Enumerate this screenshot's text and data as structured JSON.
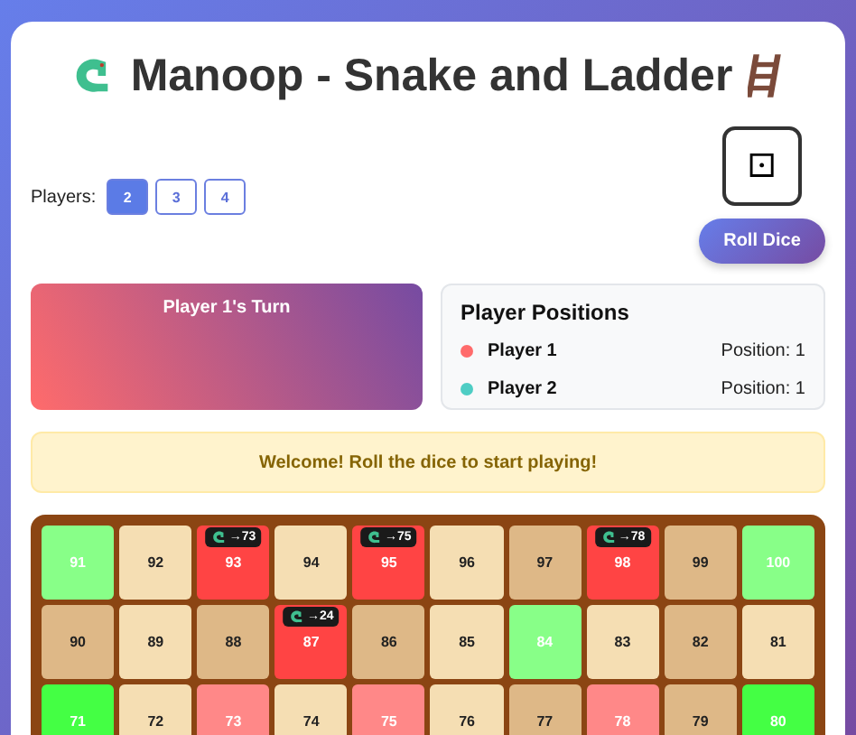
{
  "title": "Manoop - Snake and Ladder",
  "players": {
    "label": "Players:",
    "options": [
      {
        "label": "2",
        "selected": true
      },
      {
        "label": "3",
        "selected": false
      },
      {
        "label": "4",
        "selected": false
      }
    ]
  },
  "dice": {
    "face": "⚀",
    "button": "Roll Dice"
  },
  "turn": {
    "text": "Player 1's Turn"
  },
  "positions": {
    "title": "Player Positions",
    "players": [
      {
        "name": "Player 1",
        "color": "#ff6b6b",
        "position": "Position: 1"
      },
      {
        "name": "Player 2",
        "color": "#4ecdc4",
        "position": "Position: 1"
      }
    ]
  },
  "message": "Welcome! Roll the dice to start playing!",
  "board": {
    "rows": [
      [
        {
          "n": "91",
          "kind": "ladder-top"
        },
        {
          "n": "92",
          "kind": "light"
        },
        {
          "n": "93",
          "kind": "snake-head",
          "badge": "→73"
        },
        {
          "n": "94",
          "kind": "light"
        },
        {
          "n": "95",
          "kind": "snake-head",
          "badge": "→75"
        },
        {
          "n": "96",
          "kind": "light"
        },
        {
          "n": "97",
          "kind": "dark"
        },
        {
          "n": "98",
          "kind": "snake-head",
          "badge": "→78"
        },
        {
          "n": "99",
          "kind": "dark"
        },
        {
          "n": "100",
          "kind": "ladder-top"
        }
      ],
      [
        {
          "n": "90",
          "kind": "dark"
        },
        {
          "n": "89",
          "kind": "light"
        },
        {
          "n": "88",
          "kind": "dark"
        },
        {
          "n": "87",
          "kind": "snake-head",
          "badge": "→24"
        },
        {
          "n": "86",
          "kind": "dark"
        },
        {
          "n": "85",
          "kind": "light"
        },
        {
          "n": "84",
          "kind": "ladder-top"
        },
        {
          "n": "83",
          "kind": "light"
        },
        {
          "n": "82",
          "kind": "dark"
        },
        {
          "n": "81",
          "kind": "light"
        }
      ],
      [
        {
          "n": "71",
          "kind": "ladder-base"
        },
        {
          "n": "72",
          "kind": "light"
        },
        {
          "n": "73",
          "kind": "snake-tail"
        },
        {
          "n": "74",
          "kind": "light"
        },
        {
          "n": "75",
          "kind": "snake-tail"
        },
        {
          "n": "76",
          "kind": "light"
        },
        {
          "n": "77",
          "kind": "dark"
        },
        {
          "n": "78",
          "kind": "snake-tail"
        },
        {
          "n": "79",
          "kind": "dark"
        },
        {
          "n": "80",
          "kind": "ladder-base"
        }
      ]
    ]
  }
}
